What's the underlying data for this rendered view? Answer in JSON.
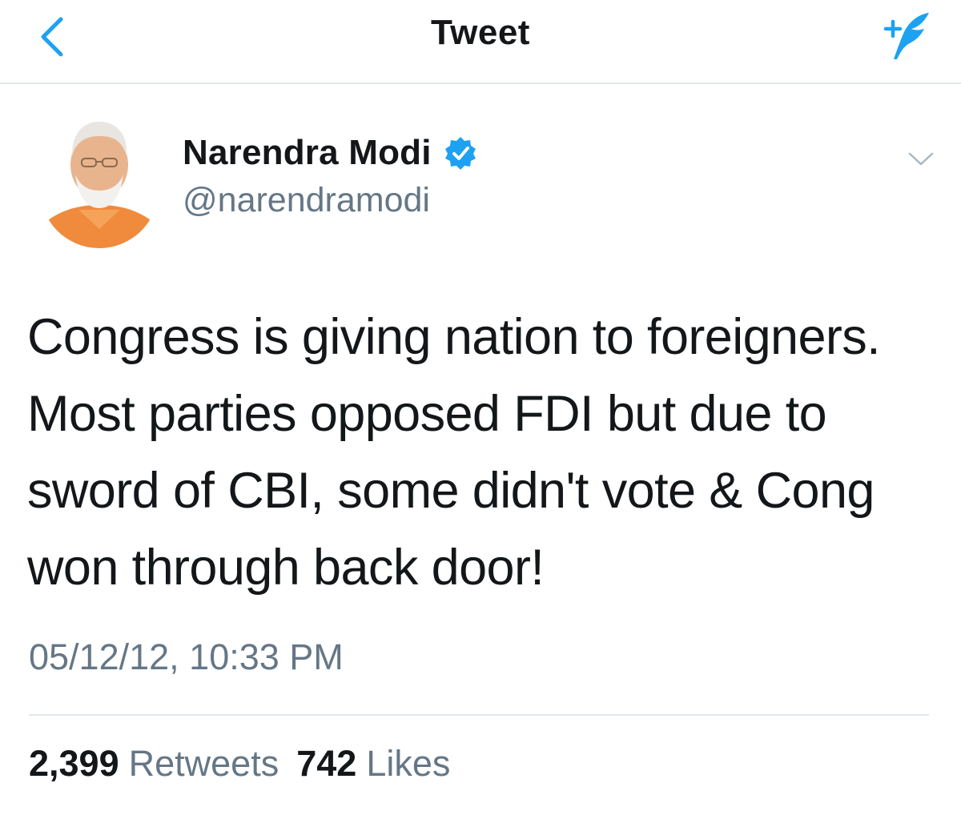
{
  "header": {
    "title": "Tweet",
    "back_icon": "chevron-left-icon",
    "compose_icon": "compose-tweet-icon"
  },
  "tweet": {
    "author_name": "Narendra Modi",
    "author_handle": "@narendramodi",
    "verified": true,
    "text": "Congress is giving nation to foreigners.\nMost parties opposed FDI but due to\nsword of CBI, some didn't vote & Cong\nwon through back door!",
    "timestamp": "05/12/12, 10:33 PM",
    "retweets_count": "2,399",
    "retweets_label": "Retweets",
    "likes_count": "742",
    "likes_label": "Likes"
  },
  "colors": {
    "accent": "#1da1f2",
    "text_primary": "#14171a",
    "text_secondary": "#657786",
    "divider": "#e1e8ed"
  }
}
